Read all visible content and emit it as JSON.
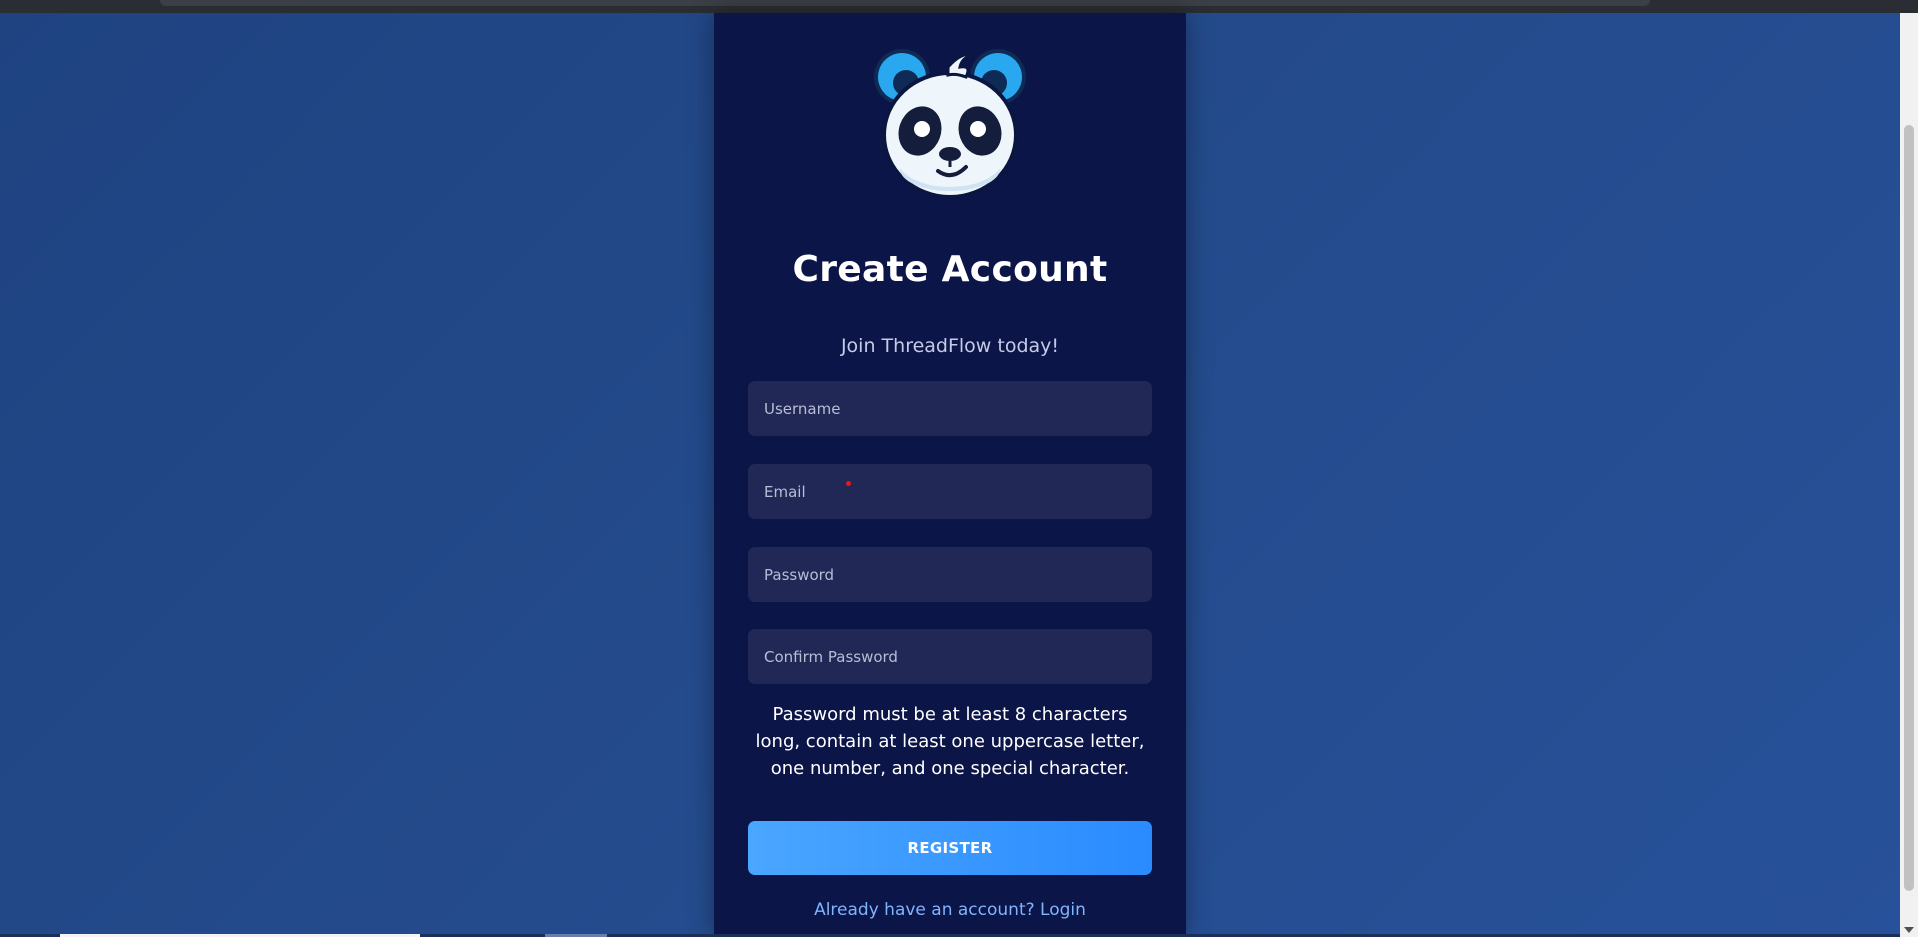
{
  "app": {
    "title": "Create Account",
    "subtitle": "Join ThreadFlow today!"
  },
  "form": {
    "username_placeholder": "Username",
    "email_placeholder": "Email",
    "password_placeholder": "Password",
    "confirm_placeholder": "Confirm Password",
    "password_hint": "Password must be at least 8 characters long, contain at least one uppercase letter, one number, and one special character.",
    "register_label": "REGISTER",
    "login_link": "Already have an account? Login"
  },
  "colors": {
    "background": "#244b8c",
    "card": "#0c1548",
    "input": "#212856",
    "accent": "#2a8bff",
    "link": "#7fb4ff",
    "required": "#e01b1b"
  },
  "icons": {
    "logo": "panda-logo-icon"
  }
}
